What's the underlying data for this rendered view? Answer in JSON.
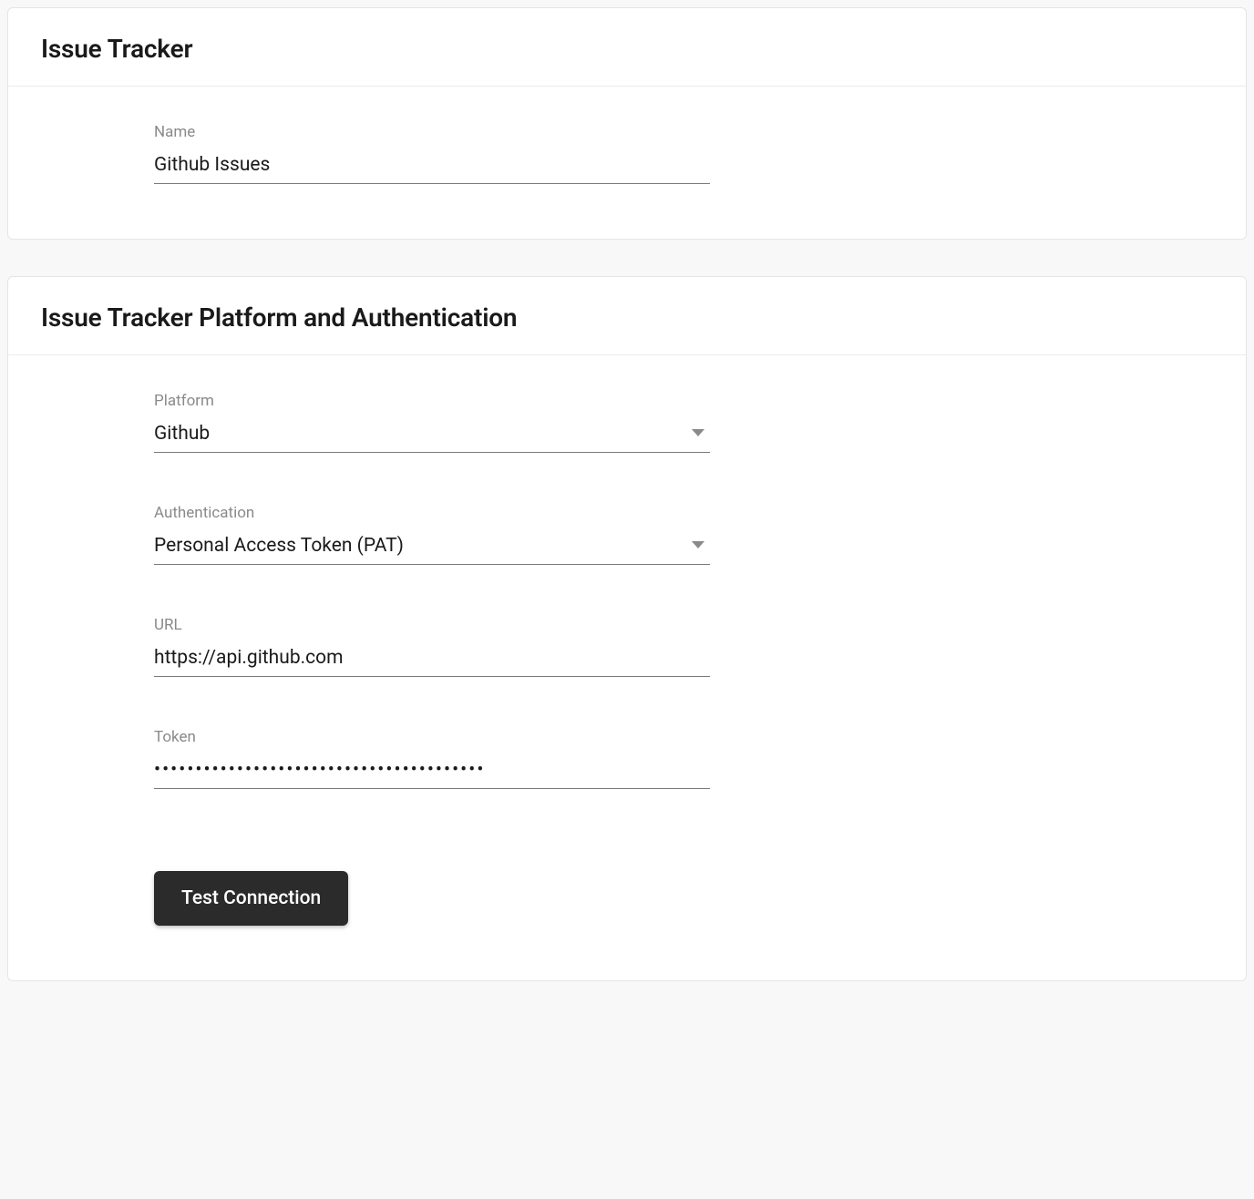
{
  "card1": {
    "title": "Issue Tracker",
    "name_label": "Name",
    "name_value": "Github Issues"
  },
  "card2": {
    "title": "Issue Tracker Platform and Authentication",
    "platform_label": "Platform",
    "platform_value": "Github",
    "auth_label": "Authentication",
    "auth_value": "Personal Access Token (PAT)",
    "url_label": "URL",
    "url_value": "https://api.github.com",
    "token_label": "Token",
    "token_value": "••••••••••••••••••••••••••••••••••••••••",
    "test_button": "Test Connection"
  }
}
